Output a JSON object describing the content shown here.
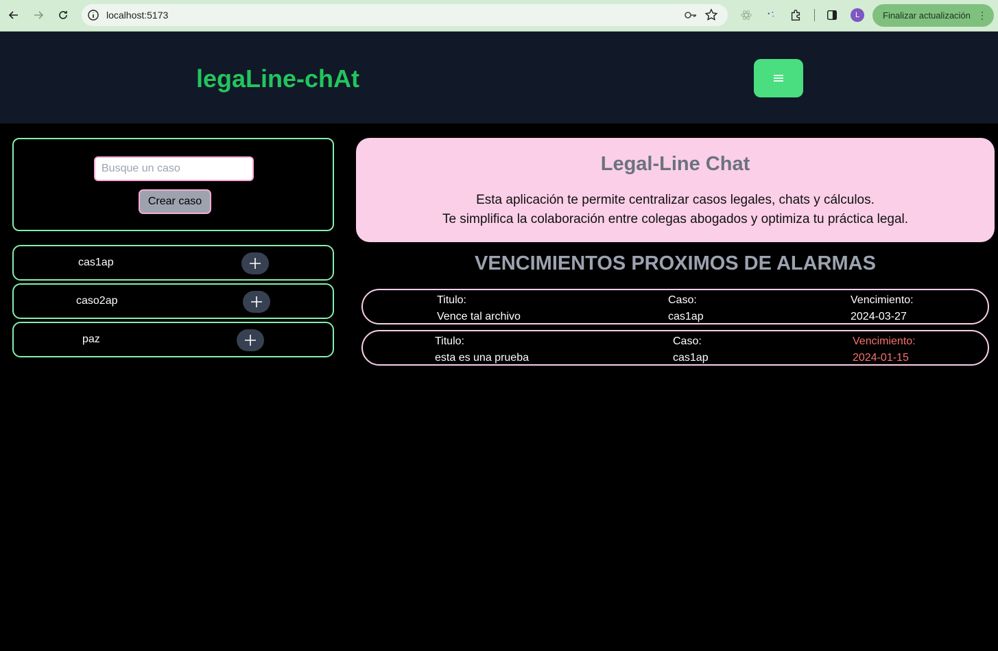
{
  "browser": {
    "url": "localhost:5173",
    "avatar_initial": "L",
    "update_label": "Finalizar actualización"
  },
  "header": {
    "brand": "legaLine-chAt"
  },
  "sidebar": {
    "search_placeholder": "Busque un caso",
    "create_label": "Crear caso",
    "cases": [
      {
        "name": "cas1ap"
      },
      {
        "name": "caso2ap"
      },
      {
        "name": "paz"
      }
    ]
  },
  "hero": {
    "title": "Legal-Line Chat",
    "line1": "Esta aplicación te permite centralizar casos legales, chats y cálculos.",
    "line2": "Te simplifica la colaboración entre colegas abogados y optimiza tu práctica legal."
  },
  "alarms": {
    "heading": "VENCIMIENTOS PROXIMOS DE ALARMAS",
    "title_label": "Titulo:",
    "case_label": "Caso:",
    "due_label": "Vencimiento:",
    "overdue_color": "#f87171",
    "items": [
      {
        "title": "Vence tal archivo",
        "case": "cas1ap",
        "due": "2024-03-27",
        "overdue": false
      },
      {
        "title": "esta es una prueba",
        "case": "cas1ap",
        "due": "2024-01-15",
        "overdue": true
      }
    ]
  }
}
